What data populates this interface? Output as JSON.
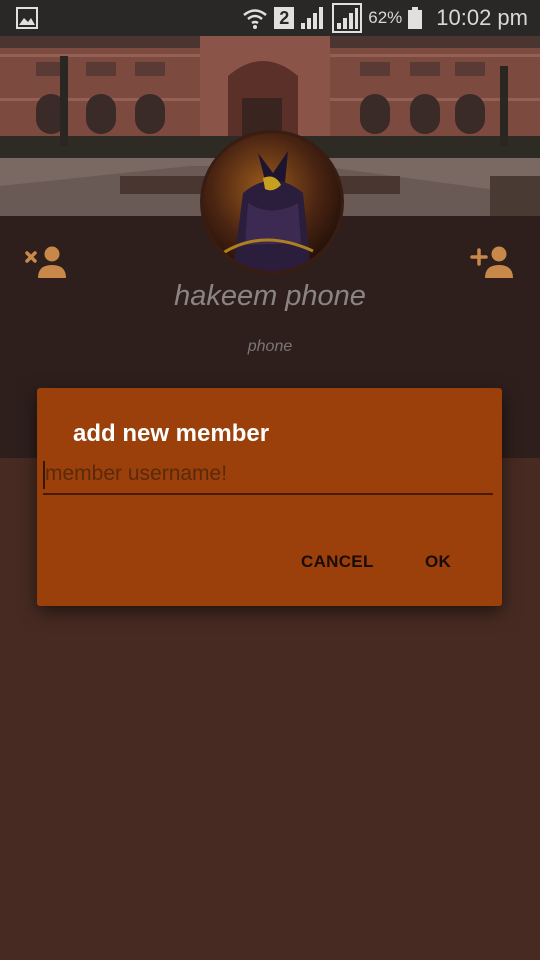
{
  "statusbar": {
    "sim_slot": "2",
    "battery_percent": "62%",
    "time": "10:02 pm",
    "left_icon": "gallery-icon",
    "icons": [
      "wifi-icon",
      "sim-icon",
      "signal-icon",
      "signal-icon",
      "battery-icon"
    ]
  },
  "profile": {
    "name": "hakeem phone",
    "subtitle": "phone",
    "remove_icon": "remove-member-icon",
    "add_icon": "add-member-icon"
  },
  "dialog": {
    "title": "add new member",
    "input_placeholder": "member username!",
    "input_value": "",
    "cancel_label": "CANCEL",
    "ok_label": "OK"
  },
  "colors": {
    "accent": "#9b3f0b",
    "icon_tint": "#c8884a",
    "background": "#472b22",
    "profile_bg": "#2e1f1c"
  }
}
